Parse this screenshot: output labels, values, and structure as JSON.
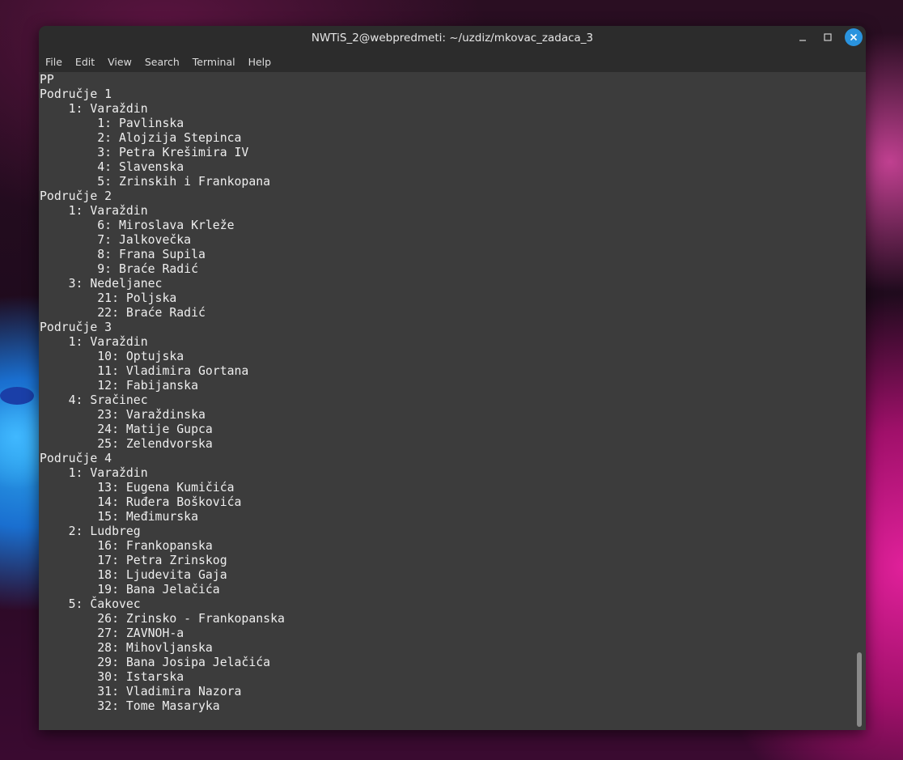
{
  "window": {
    "title": "NWTiS_2@webpredmeti: ~/uzdiz/mkovac_zadaca_3",
    "controls": {
      "minimize_icon": "minimize-icon",
      "maximize_icon": "maximize-icon",
      "close_icon": "close-icon",
      "close_color": "#2a93de"
    }
  },
  "menubar": {
    "items": [
      "File",
      "Edit",
      "View",
      "Search",
      "Terminal",
      "Help"
    ]
  },
  "terminal": {
    "background": "#3c3c3c",
    "foreground": "#eeeeee",
    "lines": [
      "PP",
      "Područje 1",
      "    1: Varaždin",
      "        1: Pavlinska",
      "        2: Alojzija Stepinca",
      "        3: Petra Krešimira IV",
      "        4: Slavenska",
      "        5: Zrinskih i Frankopana",
      "Područje 2",
      "    1: Varaždin",
      "        6: Miroslava Krleže",
      "        7: Jalkovečka",
      "        8: Frana Supila",
      "        9: Braće Radić",
      "    3: Nedeljanec",
      "        21: Poljska",
      "        22: Braće Radić",
      "Područje 3",
      "    1: Varaždin",
      "        10: Optujska",
      "        11: Vladimira Gortana",
      "        12: Fabijanska",
      "    4: Sračinec",
      "        23: Varaždinska",
      "        24: Matije Gupca",
      "        25: Zelendvorska",
      "Područje 4",
      "    1: Varaždin",
      "        13: Eugena Kumičića",
      "        14: Ruđera Boškovića",
      "        15: Međimurska",
      "    2: Ludbreg",
      "        16: Frankopanska",
      "        17: Petra Zrinskog",
      "        18: Ljudevita Gaja",
      "        19: Bana Jelačića",
      "    5: Čakovec",
      "        26: Zrinsko - Frankopanska",
      "        27: ZAVNOH-a",
      "        28: Mihovljanska",
      "        29: Bana Josipa Jelačića",
      "        30: Istarska",
      "        31: Vladimira Nazora",
      "        32: Tome Masaryka"
    ]
  }
}
